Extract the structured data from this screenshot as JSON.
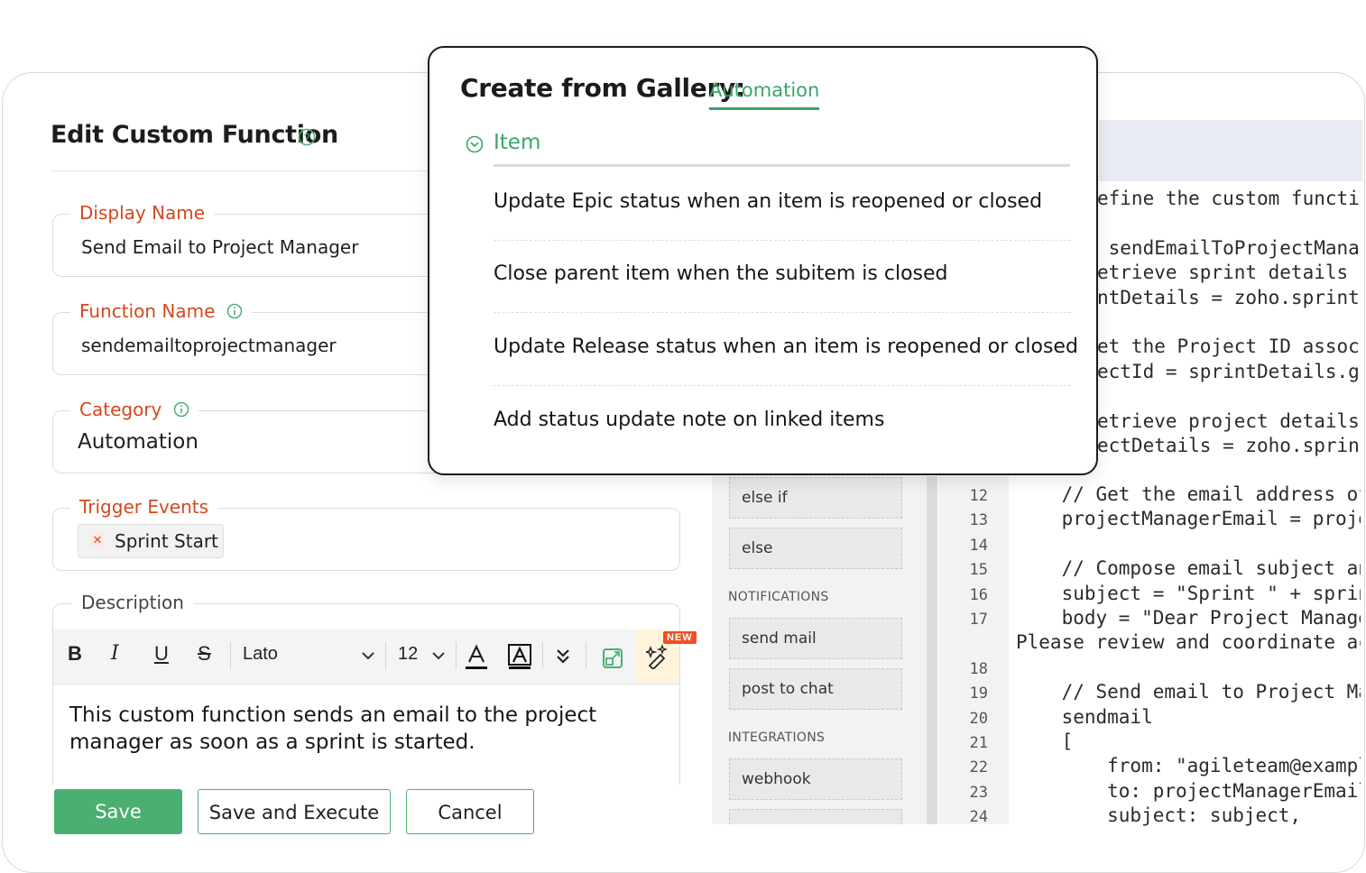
{
  "page": {
    "title": "Edit Custom Function"
  },
  "form": {
    "display_name": {
      "label": "Display Name",
      "value": "Send Email to Project Manager"
    },
    "function_name": {
      "label": "Function Name",
      "value": "sendemailtoprojectmanager"
    },
    "category": {
      "label": "Category",
      "value": "Automation"
    },
    "trigger_events": {
      "label": "Trigger Events",
      "chips": [
        "Sprint Start"
      ]
    },
    "description": {
      "label": "Description",
      "toolbar": {
        "bold": "B",
        "italic": "I",
        "underline": "U",
        "strike": "S",
        "font": "Lato",
        "size": "12",
        "new_badge": "NEW"
      },
      "text": "This custom function sends an email to the project manager as soon as a sprint is started."
    }
  },
  "buttons": {
    "save": "Save",
    "save_execute": "Save and Execute",
    "cancel": "Cancel"
  },
  "palette": {
    "control_items": [
      "else if",
      "else"
    ],
    "sections": [
      {
        "title": "NOTIFICATIONS",
        "items": [
          "send mail",
          "post to chat"
        ]
      },
      {
        "title": "INTEGRATIONS",
        "items": [
          "webhook"
        ]
      }
    ]
  },
  "code": {
    "upper_lines": [
      "efine the custom functio",
      "",
      " sendEmailToProjectMana",
      "etrieve sprint details",
      "ntDetails = zoho.sprint",
      "",
      "et the Project ID assoc",
      "ectId = sprintDetails.g",
      "",
      "etrieve project details",
      "ectDetails = zoho.sprin"
    ],
    "line_numbers": [
      "12",
      "13",
      "14",
      "15",
      "16",
      "17",
      "",
      "18",
      "19",
      "20",
      "21",
      "22",
      "23",
      "24"
    ],
    "lower_lines": [
      "    // Get the email address of",
      "    projectManagerEmail = proje",
      "",
      "    // Compose email subject an",
      "    subject = \"Sprint \" + sprin",
      "    body = \"Dear Project Manage",
      "Please review and coordinate ac",
      "",
      "    // Send email to Project Ma",
      "    sendmail",
      "    [",
      "        from: \"agileteam@exampl",
      "        to: projectManagerEmail",
      "        subject: subject,"
    ]
  },
  "gallery": {
    "title": "Create from Gallery:",
    "tab": "Automation",
    "section": "Item",
    "items": [
      "Update Epic status when an item is reopened or closed",
      "Close parent item when the subitem is closed",
      "Update Release status when an item is reopened or closed",
      "Add status update note on linked items"
    ]
  },
  "colors": {
    "accent": "#4caf72",
    "label": "#d04a1e",
    "gallery_accent": "#3ba568",
    "badge": "#f04e23"
  },
  "icons": [
    "help-circle-icon",
    "info-icon",
    "close-icon",
    "chevron-down-icon",
    "text-color-icon",
    "highlight-icon",
    "more-options-icon",
    "expand-icon",
    "magic-wand-icon",
    "collapse-circle-icon"
  ]
}
